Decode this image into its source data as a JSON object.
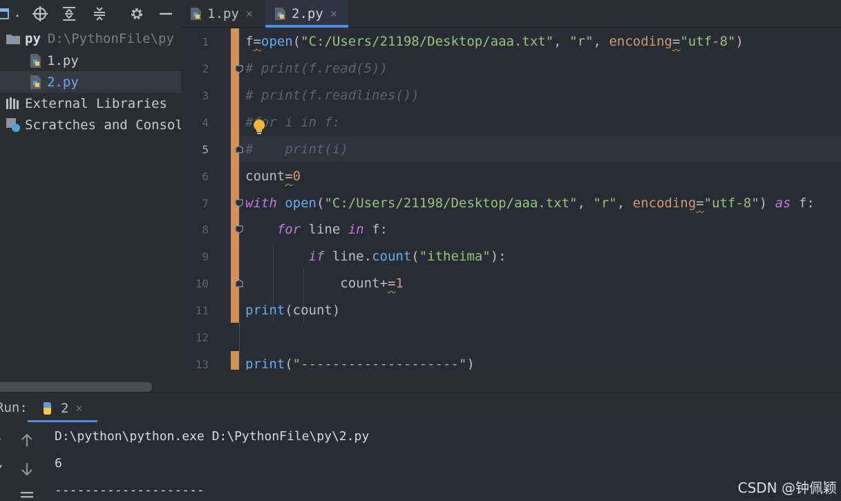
{
  "project": {
    "toolbar_icons": [
      "project-view-icon",
      "locate-icon",
      "expand-all-icon",
      "collapse-all-icon",
      "settings-icon",
      "hide-icon"
    ],
    "tree": [
      {
        "name": "py",
        "path": "D:\\PythonFile\\py",
        "icon": "folder-icon"
      },
      {
        "name": "1.py",
        "icon": "python-file-icon"
      },
      {
        "name": "2.py",
        "icon": "python-file-icon"
      },
      {
        "name": "External Libraries",
        "icon": "libraries-icon"
      },
      {
        "name": "Scratches and Consoles",
        "icon": "scratches-icon"
      }
    ]
  },
  "editor": {
    "tabs": [
      {
        "label": "1.py",
        "active": false
      },
      {
        "label": "2.py",
        "active": true
      }
    ],
    "line_numbers": [
      "1",
      "2",
      "3",
      "4",
      "5",
      "6",
      "7",
      "8",
      "9",
      "10",
      "11",
      "12",
      "13"
    ],
    "lines": [
      "f=open(\"C:/Users/21198/Desktop/aaa.txt\", \"r\", encoding=\"utf-8\")",
      "# print(f.read(5))",
      "# print(f.readlines())",
      "#for i in f:",
      "#    print(i)",
      "count=0",
      "with open(\"C:/Users/21198/Desktop/aaa.txt\", \"r\", encoding=\"utf-8\") as f:",
      "    for line in f:",
      "        if line.count(\"itheima\"):",
      "            count+=1",
      "print(count)",
      "",
      "print(\"--------------------\")"
    ]
  },
  "run": {
    "label": "Run:",
    "tab_label": "2",
    "output": [
      "D:\\python\\python.exe D:\\PythonFile\\py\\2.py",
      "6",
      "--------------------"
    ]
  },
  "watermark": "CSDN @钟佩颖",
  "colors": {
    "keyword": "#c678dd",
    "function": "#61afef",
    "string": "#98c379",
    "number": "#d19a66",
    "comment": "#5c6370",
    "change_marker": "#d49155",
    "accent": "#4e8ce3"
  }
}
